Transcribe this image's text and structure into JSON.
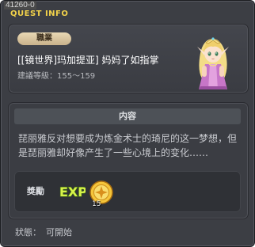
{
  "window": {
    "quest_id": "41260-0",
    "title": "QUEST INFO"
  },
  "quest": {
    "job_label": "職業",
    "name": "[[镜世界]玛加提亚] 妈妈了如指掌",
    "level": "建議等級：155～159"
  },
  "content": {
    "header": "内容",
    "text": "琵丽雅反对想要成为炼金术士的琦尼的这一梦想，但是琵丽雅却好像产生了一些心境上的变化……"
  },
  "reward": {
    "label": "獎勵",
    "exp_icon": "exp-icon",
    "medal_icon": "gold-medal-icon",
    "medal_count": "15"
  },
  "status": {
    "label": "狀態：",
    "value": "可開始"
  },
  "npc": {
    "icon": "npc-portrait-elf-girl"
  },
  "colors": {
    "title": "#f2d24a",
    "background": "#3c3e44",
    "job_pill": "#e9d8b4"
  }
}
